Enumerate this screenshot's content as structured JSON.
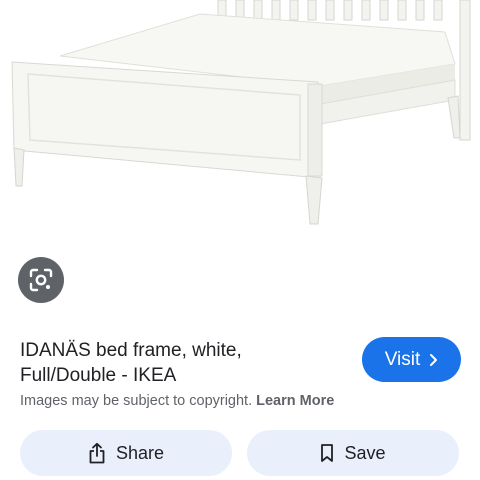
{
  "result": {
    "title_line1": "IDANÄS bed frame, white,",
    "title_line2": "Full/Double - IKEA",
    "visit_label": "Visit",
    "copyright_text": "Images may be subject to copyright.",
    "learn_more_label": "Learn More"
  },
  "actions": {
    "share_label": "Share",
    "save_label": "Save"
  },
  "icons": {
    "lens": "google-lens-icon",
    "visit": "chevron-right-icon",
    "share": "share-icon",
    "save": "bookmark-icon"
  },
  "colors": {
    "visit_button": "#1a73e8",
    "action_button_bg": "#e9effb",
    "lens_button_bg": "#5f6368"
  }
}
